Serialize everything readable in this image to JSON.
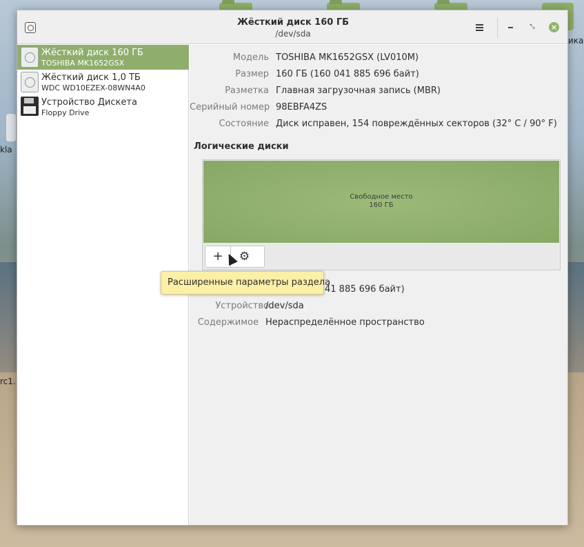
{
  "desktop": {
    "label_left_1": "kla",
    "label_left_2": "rc1.",
    "label_right": "ика"
  },
  "window": {
    "title": "Жёсткий диск 160 ГБ",
    "subtitle": "/dev/sda",
    "close_symbol": "×",
    "maximize_symbol": "⤡"
  },
  "sidebar": {
    "items": [
      {
        "name": "Жёсткий диск 160 ГБ",
        "sub": "TOSHIBA MK1652GSX",
        "icon": "hard-disk-icon",
        "selected": true
      },
      {
        "name": "Жёсткий диск 1,0 ТБ",
        "sub": "WDC WD10EZEX-08WN4A0",
        "icon": "hard-disk-icon",
        "selected": false
      },
      {
        "name": "Устройство Дискета",
        "sub": "Floppy Drive",
        "icon": "floppy-icon",
        "selected": false
      }
    ]
  },
  "drive_props": {
    "model_label": "Модель",
    "model_value": "TOSHIBA MK1652GSX (LV010M)",
    "size_label": "Размер",
    "size_value": "160 ГБ (160 041 885 696 байт)",
    "partitioning_label": "Разметка",
    "partitioning_value": "Главная загрузочная запись (MBR)",
    "serial_label": "Серийный номер",
    "serial_value": "98EBFA4ZS",
    "status_label": "Состояние",
    "status_value": "Диск исправен, 154 повреждённых секторов (32° C / 90° F)"
  },
  "volumes": {
    "section_title": "Логические диски",
    "free_label": "Свободное место",
    "free_size": "160 ГБ",
    "add_symbol": "+",
    "gear_symbol": "⚙"
  },
  "volume_props": {
    "size_value_partial": "41 885 696 байт)",
    "device_label": "Устройство",
    "device_value": "/dev/sda",
    "contents_label": "Содержимое",
    "contents_value": "Нераспределённое пространство"
  },
  "tooltip": {
    "text": "Расширенные параметры раздела"
  },
  "colors": {
    "accent": "#8fae6c",
    "free_space": "#87a865",
    "tooltip_bg": "#fbf0a6"
  }
}
